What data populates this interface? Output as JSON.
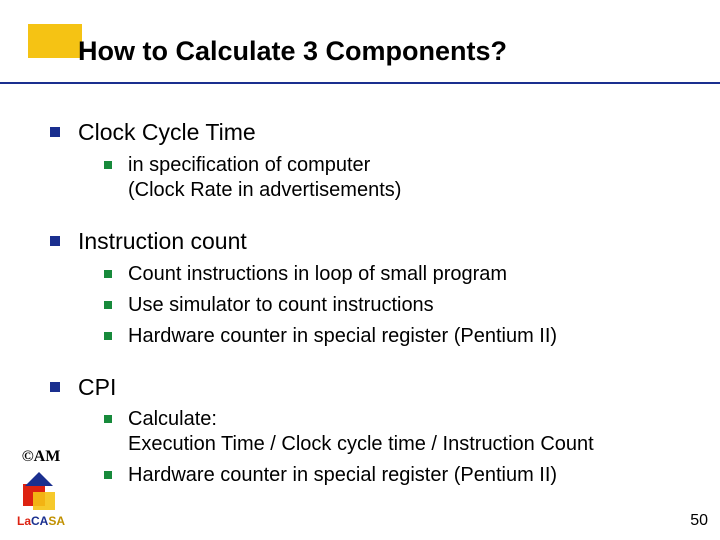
{
  "title": "How to Calculate 3 Components?",
  "sections": [
    {
      "heading": "Clock Cycle Time",
      "items": [
        "in specification of computer\n(Clock Rate in advertisements)"
      ]
    },
    {
      "heading": "Instruction count",
      "items": [
        "Count instructions in loop of small program",
        "Use simulator to count instructions",
        "Hardware counter in special register (Pentium II)"
      ]
    },
    {
      "heading": "CPI",
      "items": [
        "Calculate:\nExecution Time / Clock cycle time / Instruction Count",
        "Hardware counter in special register (Pentium II)"
      ]
    }
  ],
  "footer": {
    "copyright": "©AM",
    "lab": {
      "la": "La",
      "ca": "CA",
      "sa": "SA"
    }
  },
  "page_number": "50"
}
